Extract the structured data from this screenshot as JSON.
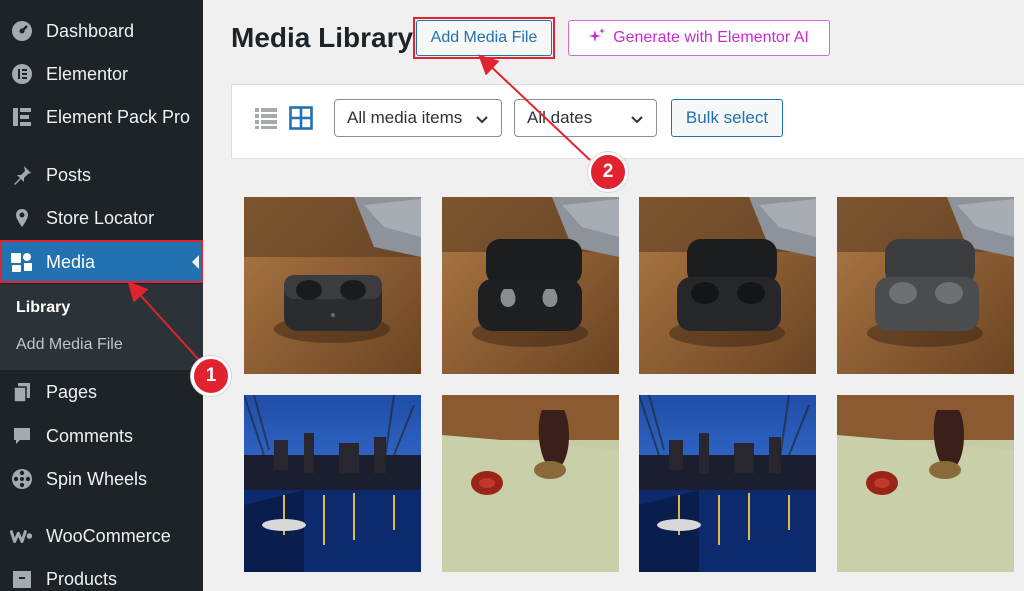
{
  "sidebar": {
    "items": [
      {
        "label": "Dashboard",
        "icon": "dashboard-icon"
      },
      {
        "label": "Elementor",
        "icon": "elementor-icon"
      },
      {
        "label": "Element Pack Pro",
        "icon": "element-pack-icon"
      },
      {
        "label": "Posts",
        "icon": "pin-icon"
      },
      {
        "label": "Store Locator",
        "icon": "location-pin-icon"
      },
      {
        "label": "Media",
        "icon": "media-icon"
      },
      {
        "label": "Pages",
        "icon": "pages-icon"
      },
      {
        "label": "Comments",
        "icon": "comment-icon"
      },
      {
        "label": "Spin Wheels",
        "icon": "wheel-icon"
      },
      {
        "label": "WooCommerce",
        "icon": "woocommerce-icon"
      },
      {
        "label": "Products",
        "icon": "products-icon"
      }
    ],
    "media_submenu": [
      {
        "label": "Library",
        "current": true
      },
      {
        "label": "Add Media File",
        "current": false
      }
    ]
  },
  "main": {
    "title": "Media Library",
    "add_button": "Add Media File",
    "ai_button": "Generate with Elementor AI",
    "filters": {
      "type_select": "All media items",
      "date_select": "All dates",
      "bulk_button": "Bulk select"
    },
    "thumbnails": [
      {
        "subject": "black earbuds case on wooden table"
      },
      {
        "subject": "open earbuds case with earbuds"
      },
      {
        "subject": "black earbuds case with earbuds"
      },
      {
        "subject": "grey earbuds case with earbuds"
      },
      {
        "subject": "canal city at night"
      },
      {
        "subject": "wax seal stamp on paper"
      },
      {
        "subject": "canal city at night"
      },
      {
        "subject": "wax seal stamp on paper"
      }
    ]
  },
  "annotations": {
    "step1": "1",
    "step2": "2"
  },
  "colors": {
    "sidebar_bg": "#1d2327",
    "active_bg": "#2271b1",
    "annotation_red": "#e0232e",
    "ai_purple": "#c72bd1"
  }
}
